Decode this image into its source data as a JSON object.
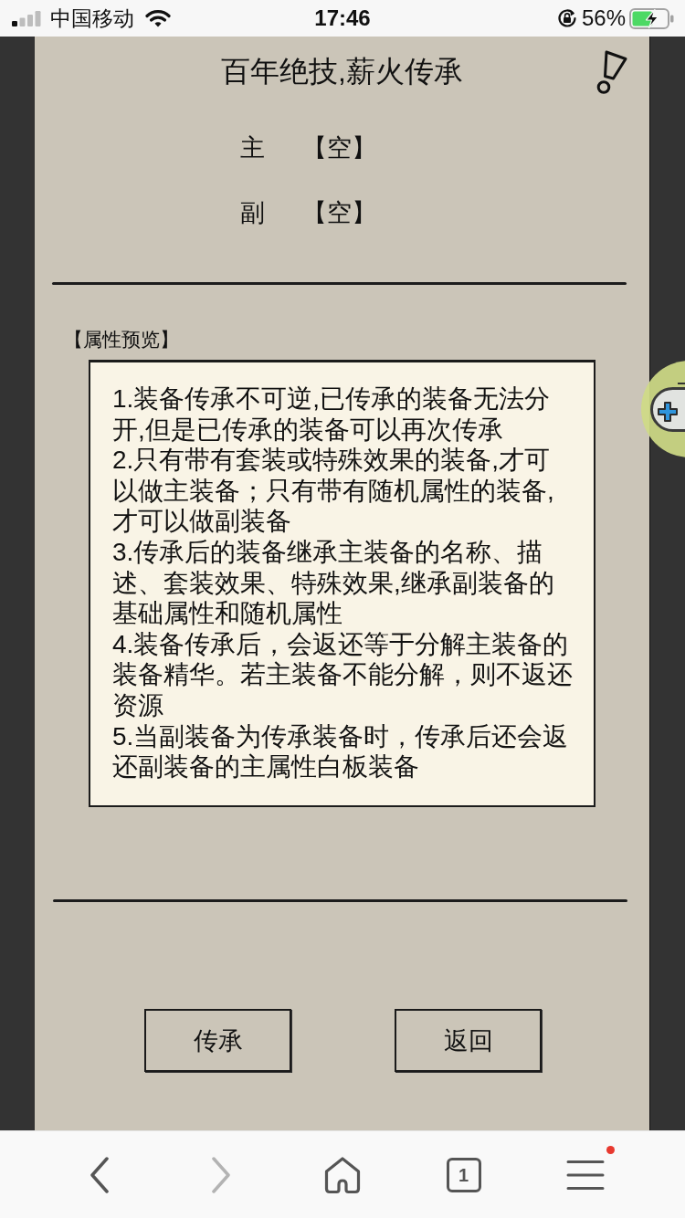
{
  "status_bar": {
    "carrier": "中国移动",
    "time": "17:46",
    "battery_percent": "56%"
  },
  "header": {
    "title": "百年绝技,薪火传承"
  },
  "slots": [
    {
      "label": "主",
      "value": "【空】"
    },
    {
      "label": "副",
      "value": "【空】"
    }
  ],
  "preview": {
    "heading": "【属性预览】",
    "items": [
      "1.装备传承不可逆,已传承的装备无法分开,但是已传承的装备可以再次传承",
      "2.只有带有套装或特殊效果的装备,才可以做主装备；只有带有随机属性的装备,才可以做副装备",
      "3.传承后的装备继承主装备的名称、描述、套装效果、特殊效果,继承副装备的基础属性和随机属性",
      "4.装备传承后，会返还等于分解主装备的装备精华。若主装备不能分解，则不返还资源",
      "5.当副装备为传承装备时，传承后还会返还副装备的主属性白板装备"
    ]
  },
  "buttons": [
    {
      "label": "传承"
    },
    {
      "label": "返回"
    }
  ],
  "browser_bar": {
    "items": [
      {
        "kind": "back",
        "disabled": false,
        "badge": false
      },
      {
        "kind": "forward",
        "disabled": true,
        "badge": false
      },
      {
        "kind": "home",
        "disabled": false,
        "badge": false
      },
      {
        "kind": "tabs",
        "label": "1",
        "disabled": false,
        "badge": false
      },
      {
        "kind": "menu",
        "disabled": false,
        "badge": true
      }
    ]
  }
}
